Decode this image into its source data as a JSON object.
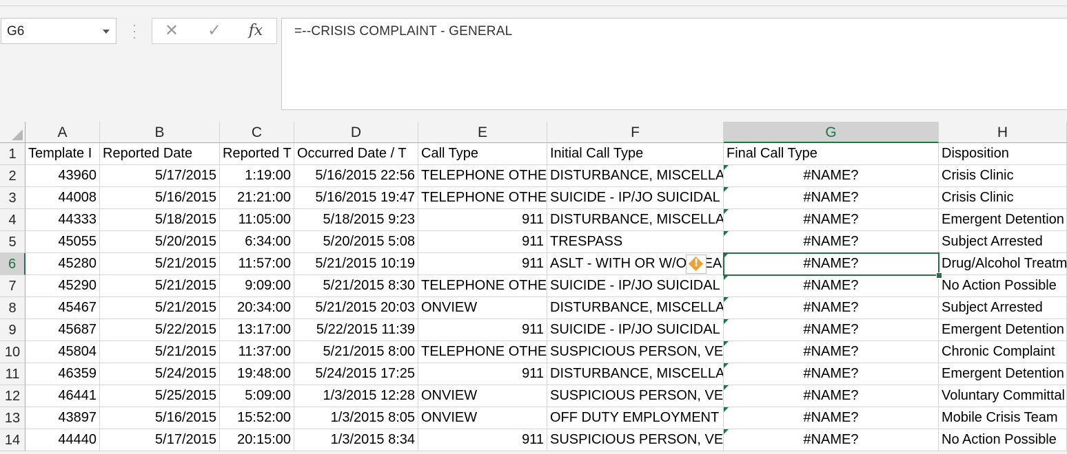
{
  "name_box": {
    "value": "G6"
  },
  "formula_bar": {
    "cancel_icon": "x-icon",
    "enter_icon": "check-icon",
    "function_label": "fx",
    "formula": "=--CRISIS COMPLAINT - GENERAL"
  },
  "sheet": {
    "selected_cell": "G6",
    "columns": [
      {
        "letter": "A"
      },
      {
        "letter": "B"
      },
      {
        "letter": "C"
      },
      {
        "letter": "D"
      },
      {
        "letter": "E"
      },
      {
        "letter": "F"
      },
      {
        "letter": "G"
      },
      {
        "letter": "H"
      }
    ],
    "row_numbers": [
      "1",
      "2",
      "3",
      "4",
      "5",
      "6",
      "7",
      "8",
      "9",
      "10",
      "11",
      "12",
      "13",
      "14"
    ],
    "rows": [
      [
        "Template I",
        "Reported Date",
        "Reported T",
        "Occurred Date / T",
        "Call Type",
        "Initial Call Type",
        "Final Call Type",
        "Disposition"
      ],
      [
        "43960",
        "5/17/2015",
        "1:19:00",
        "5/16/2015 22:56",
        "TELEPHONE OTHER",
        "DISTURBANCE, MISCELLANEOUS",
        "#NAME?",
        "Crisis Clinic"
      ],
      [
        "44008",
        "5/16/2015",
        "21:21:00",
        "5/16/2015 19:47",
        "TELEPHONE OTHER",
        "SUICIDE - IP/JO SUICIDAL",
        "#NAME?",
        "Crisis Clinic"
      ],
      [
        "44333",
        "5/18/2015",
        "11:05:00",
        "5/18/2015 9:23",
        "911",
        "DISTURBANCE, MISCELLANEOUS",
        "#NAME?",
        "Emergent Detention"
      ],
      [
        "45055",
        "5/20/2015",
        "6:34:00",
        "5/20/2015 5:08",
        "911",
        "TRESPASS",
        "#NAME?",
        "Subject Arrested"
      ],
      [
        "45280",
        "5/21/2015",
        "11:57:00",
        "5/21/2015 10:19",
        "911",
        "ASLT - WITH OR W/O WEAPON",
        "#NAME?",
        "Drug/Alcohol Treatment"
      ],
      [
        "45290",
        "5/21/2015",
        "9:09:00",
        "5/21/2015 8:30",
        "TELEPHONE OTHER",
        "SUICIDE - IP/JO SUICIDAL",
        "#NAME?",
        "No Action Possible"
      ],
      [
        "45467",
        "5/21/2015",
        "20:34:00",
        "5/21/2015 20:03",
        "ONVIEW",
        "DISTURBANCE, MISCELLANEOUS",
        "#NAME?",
        "Subject Arrested"
      ],
      [
        "45687",
        "5/22/2015",
        "13:17:00",
        "5/22/2015 11:39",
        "911",
        "SUICIDE - IP/JO SUICIDAL",
        "#NAME?",
        "Emergent Detention"
      ],
      [
        "45804",
        "5/21/2015",
        "11:37:00",
        "5/21/2015 8:00",
        "TELEPHONE OTHER",
        "SUSPICIOUS PERSON, VEHICLE",
        "#NAME?",
        "Chronic Complaint"
      ],
      [
        "46359",
        "5/24/2015",
        "19:48:00",
        "5/24/2015 17:25",
        "911",
        "DISTURBANCE, MISCELLANEOUS",
        "#NAME?",
        "Emergent Detention"
      ],
      [
        "46441",
        "5/25/2015",
        "5:09:00",
        "1/3/2015 12:28",
        "ONVIEW",
        "SUSPICIOUS PERSON, VEHICLE",
        "#NAME?",
        "Voluntary Committal"
      ],
      [
        "43897",
        "5/16/2015",
        "15:52:00",
        "1/3/2015 8:05",
        "ONVIEW",
        "OFF DUTY EMPLOYMENT",
        "#NAME?",
        "Mobile Crisis Team"
      ],
      [
        "44440",
        "5/17/2015",
        "20:15:00",
        "1/3/2015 8:34",
        "911",
        "SUSPICIOUS PERSON, VEHICLE",
        "#NAME?",
        "No Action Possible"
      ]
    ],
    "error_indicator_icon": "warning-diamond-icon",
    "error_indicator_mark": "!"
  }
}
